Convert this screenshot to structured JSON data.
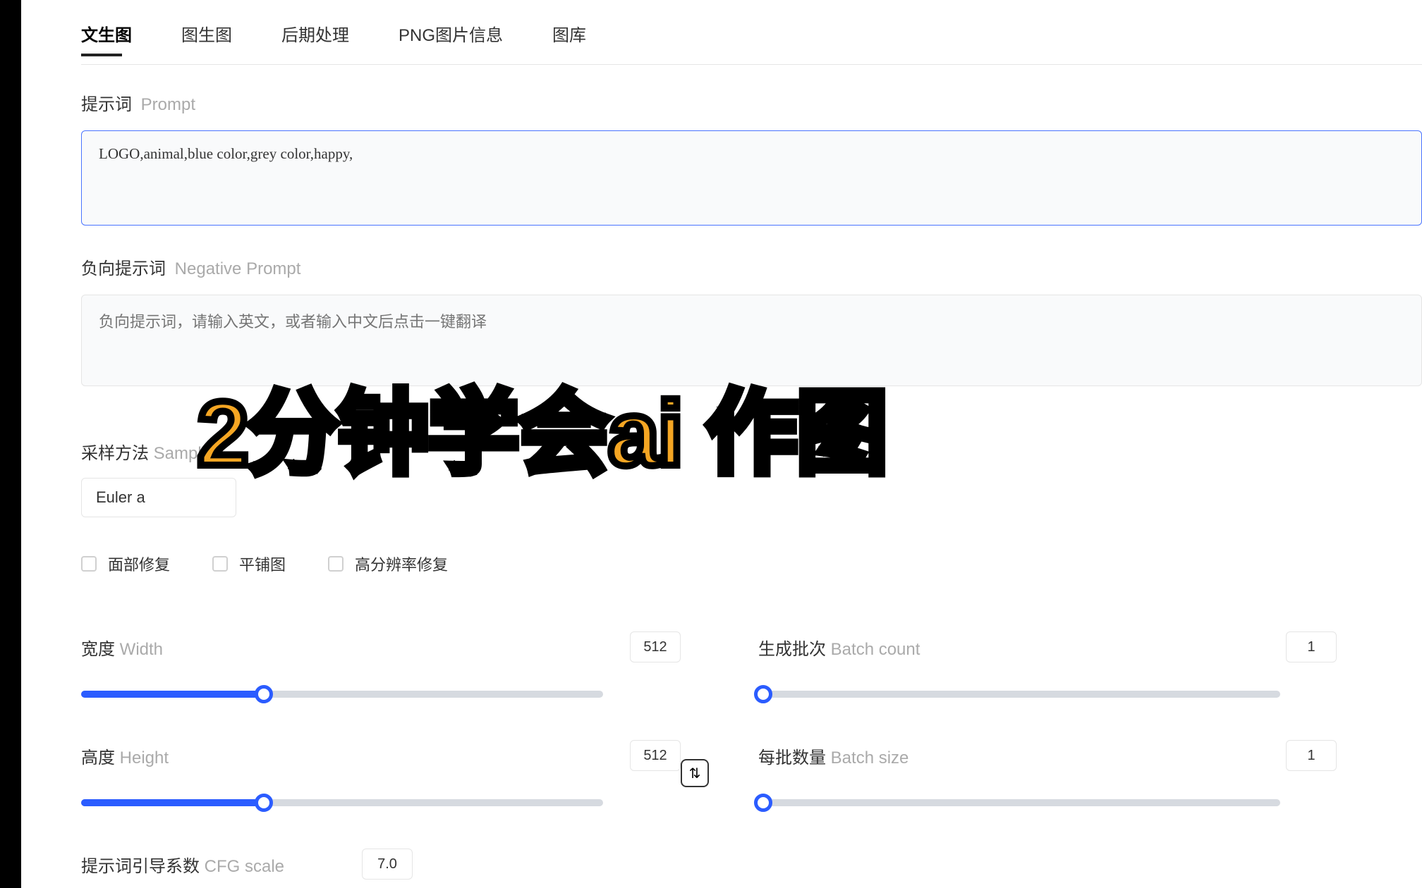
{
  "tabs": {
    "txt2img": "文生图",
    "img2img": "图生图",
    "postprocess": "后期处理",
    "pnginfo": "PNG图片信息",
    "gallery": "图库"
  },
  "prompt": {
    "label_cn": "提示词",
    "label_en": "Prompt",
    "value": "LOGO,animal,blue color,grey color,happy,"
  },
  "neg_prompt": {
    "label_cn": "负向提示词",
    "label_en": "Negative Prompt",
    "placeholder": "负向提示词，请输入英文，或者输入中文后点击一键翻译"
  },
  "sampler": {
    "label_cn": "采样方法",
    "label_en": "Sample",
    "value": "Euler a"
  },
  "checkboxes": {
    "face_restore": "面部修复",
    "tile": "平铺图",
    "hires": "高分辨率修复"
  },
  "sliders": {
    "width": {
      "label_cn": "宽度",
      "label_en": "Width",
      "value": "512",
      "pct": 35
    },
    "height": {
      "label_cn": "高度",
      "label_en": "Height",
      "value": "512",
      "pct": 35
    },
    "batch_count": {
      "label_cn": "生成批次",
      "label_en": "Batch count",
      "value": "1",
      "pct": 0
    },
    "batch_size": {
      "label_cn": "每批数量",
      "label_en": "Batch size",
      "value": "1",
      "pct": 0
    }
  },
  "cfg": {
    "label_cn": "提示词引导系数",
    "label_en": "CFG scale",
    "value": "7.0"
  },
  "overlay": "2分钟学会ai  作图",
  "swap_icon": "⇅"
}
